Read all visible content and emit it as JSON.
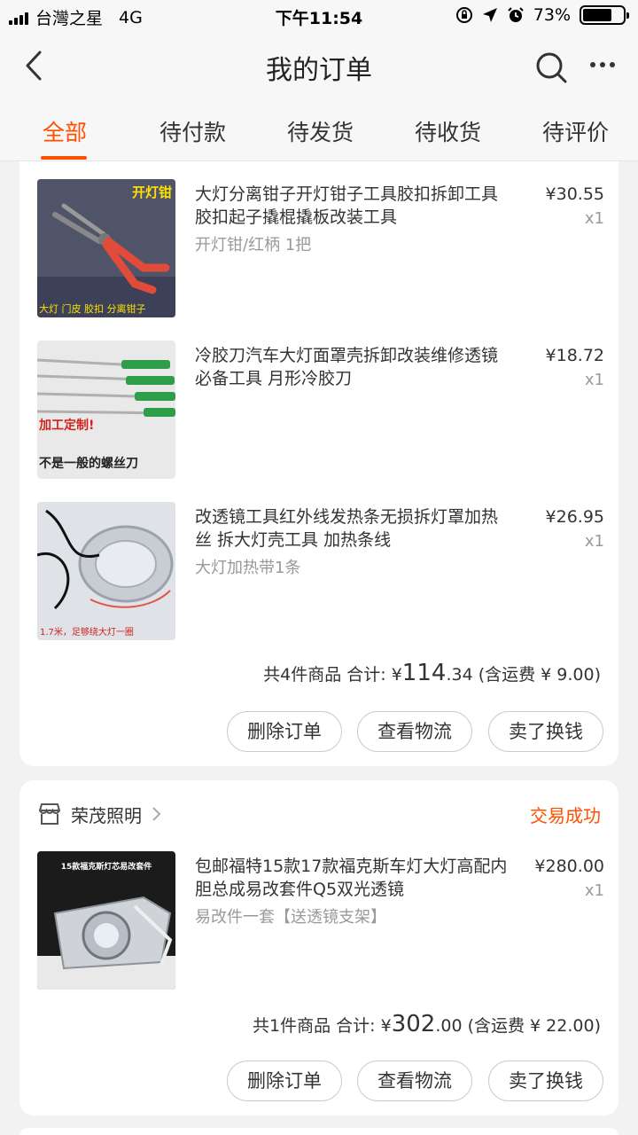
{
  "status_bar": {
    "carrier": "台灣之星",
    "network": "4G",
    "time": "下午11:54",
    "battery": "73%",
    "battery_level": 0.73
  },
  "nav": {
    "title": "我的订单"
  },
  "tabs": [
    {
      "label": "全部"
    },
    {
      "label": "待付款"
    },
    {
      "label": "待发货"
    },
    {
      "label": "待收货"
    },
    {
      "label": "待评价"
    }
  ],
  "order1": {
    "items": [
      {
        "title": "大灯分离钳子开灯钳子工具胶扣拆卸工具胶扣起子撬棍撬板改装工具",
        "sku": "开灯钳/红柄 1把",
        "price": "¥30.55",
        "qty": "x1",
        "thumb_text_top": "开灯钳",
        "thumb_text_bottom": "大灯 门皮 胶扣 分离钳子"
      },
      {
        "title": "冷胶刀汽车大灯面罩壳拆卸改装维修透镜必备工具 月形冷胶刀",
        "sku": "",
        "price": "¥18.72",
        "qty": "x1",
        "thumb_text_top": "加工定制!",
        "thumb_text_bottom": "不是一般的螺丝刀"
      },
      {
        "title": "改透镜工具红外线发热条无损拆灯罩加热丝 拆大灯壳工具 加热条线",
        "sku": "大灯加热带1条",
        "price": "¥26.95",
        "qty": "x1",
        "thumb_text_top": "",
        "thumb_text_bottom": "1.7米，足够绕大灯一圈"
      }
    ],
    "summary_prefix": "共4件商品 合计: ¥",
    "total_int": "114",
    "total_dec": ".34",
    "summary_suffix": " (含运费 ¥ 9.00)",
    "buttons": {
      "delete": "删除订单",
      "logistics": "查看物流",
      "resell": "卖了换钱"
    }
  },
  "order2": {
    "shop_name": "荣茂照明",
    "status": "交易成功",
    "items": [
      {
        "title": "包邮福特15款17款福克斯车灯大灯高配内胆总成易改套件Q5双光透镜",
        "sku": "易改件一套【送透镜支架】",
        "price": "¥280.00",
        "qty": "x1",
        "thumb_text_top": "15款福克斯灯芯易改套件"
      }
    ],
    "summary_prefix": "共1件商品 合计: ¥",
    "total_int": "302",
    "total_dec": ".00",
    "summary_suffix": " (含运费 ¥ 22.00)",
    "buttons": {
      "delete": "删除订单",
      "logistics": "查看物流",
      "resell": "卖了换钱"
    }
  },
  "colors": {
    "accent": "#ff5000",
    "background": "#f2f2f2",
    "card": "#ffffff"
  }
}
